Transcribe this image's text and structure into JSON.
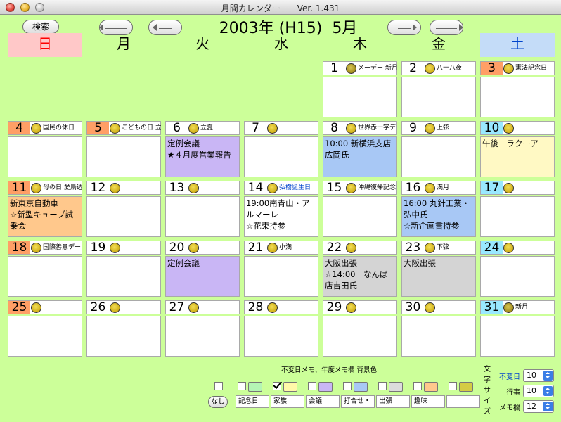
{
  "window": {
    "title": "月間カレンダー　　Ver. 1.431"
  },
  "toolbar": {
    "search_label": "検索"
  },
  "month_title": "2003年 (H15)  5月",
  "weekdays": [
    {
      "label": "日",
      "bg": "#ffc8c8",
      "color": "#ff0000"
    },
    {
      "label": "月",
      "bg": "",
      "color": "#000000"
    },
    {
      "label": "火",
      "bg": "",
      "color": "#000000"
    },
    {
      "label": "水",
      "bg": "",
      "color": "#000000"
    },
    {
      "label": "木",
      "bg": "",
      "color": "#000000"
    },
    {
      "label": "金",
      "bg": "",
      "color": "#000000"
    },
    {
      "label": "土",
      "bg": "#c4dcf8",
      "color": "#0044cc"
    }
  ],
  "colors": {
    "sunday_head": "#ff9f66",
    "saturday_head": "#99e8ff",
    "memo_purple": "#c9b6f5",
    "memo_blue": "#a8c8f5",
    "memo_yellow": "#fff9c4",
    "memo_orange": "#ffc88c",
    "memo_gray": "#d4d4d4"
  },
  "days": [
    {
      "day": "1",
      "holiday": "メーデー 新月",
      "notes": [],
      "memo": ""
    },
    {
      "day": "2",
      "holiday": "八十八夜",
      "notes": [],
      "memo": ""
    },
    {
      "day": "3",
      "holiday": "憲法記念日",
      "notes": [],
      "memo": "",
      "head": "sunday_head"
    },
    {
      "day": "4",
      "holiday": "国民の休日",
      "notes": [],
      "memo": "",
      "head": "sunday_head"
    },
    {
      "day": "5",
      "holiday": "こどもの日 立",
      "notes": [],
      "memo": "",
      "head": "sunday_head"
    },
    {
      "day": "6",
      "holiday": "立夏",
      "notes": [
        "定例会議",
        "★４月度営業報告"
      ],
      "memo": "memo_purple"
    },
    {
      "day": "7",
      "holiday": "",
      "notes": [],
      "memo": ""
    },
    {
      "day": "8",
      "holiday": "世界赤十字デ",
      "notes": [
        "10:00 新横浜支店",
        "広岡氏"
      ],
      "memo": "memo_blue"
    },
    {
      "day": "9",
      "holiday": "上弦",
      "notes": [],
      "memo": ""
    },
    {
      "day": "10",
      "holiday": "",
      "notes": [
        "午後　ラクーア"
      ],
      "memo": "memo_yellow",
      "head": "saturday_head"
    },
    {
      "day": "11",
      "holiday": "母の日 愛鳥週",
      "notes": [
        "新東京自動車",
        "☆新型キューブ試",
        "乗会"
      ],
      "memo": "memo_orange",
      "head": "sunday_head"
    },
    {
      "day": "12",
      "holiday": "",
      "notes": [],
      "memo": ""
    },
    {
      "day": "13",
      "holiday": "",
      "notes": [],
      "memo": ""
    },
    {
      "day": "14",
      "holiday": "弘樹誕生日",
      "holiday_color": "#0044cc",
      "notes": [
        "19:00南青山・ア",
        "ルマーレ",
        "☆花束持参"
      ],
      "memo": ""
    },
    {
      "day": "15",
      "holiday": "沖縄復帰記念",
      "notes": [],
      "memo": ""
    },
    {
      "day": "16",
      "holiday": "満月",
      "notes": [
        "16:00 丸針工業・",
        "弘中氏",
        "☆新企画書持参"
      ],
      "memo": "memo_blue"
    },
    {
      "day": "17",
      "holiday": "",
      "notes": [],
      "memo": "",
      "head": "saturday_head"
    },
    {
      "day": "18",
      "holiday": "国際善意デー",
      "notes": [],
      "memo": "",
      "head": "sunday_head"
    },
    {
      "day": "19",
      "holiday": "",
      "notes": [],
      "memo": ""
    },
    {
      "day": "20",
      "holiday": "",
      "notes": [
        "定例会議"
      ],
      "memo": "memo_purple"
    },
    {
      "day": "21",
      "holiday": "小満",
      "notes": [],
      "memo": ""
    },
    {
      "day": "22",
      "holiday": "",
      "notes": [
        "大阪出張",
        "☆14:00　なんば",
        "店吉田氏"
      ],
      "memo": "memo_gray"
    },
    {
      "day": "23",
      "holiday": "下弦",
      "notes": [
        "大阪出張"
      ],
      "memo": "memo_gray"
    },
    {
      "day": "24",
      "holiday": "",
      "notes": [],
      "memo": "",
      "head": "saturday_head"
    },
    {
      "day": "25",
      "holiday": "",
      "notes": [],
      "memo": "",
      "head": "sunday_head"
    },
    {
      "day": "26",
      "holiday": "",
      "notes": [],
      "memo": ""
    },
    {
      "day": "27",
      "holiday": "",
      "notes": [],
      "memo": ""
    },
    {
      "day": "28",
      "holiday": "",
      "notes": [],
      "memo": ""
    },
    {
      "day": "29",
      "holiday": "",
      "notes": [],
      "memo": ""
    },
    {
      "day": "30",
      "holiday": "",
      "notes": [],
      "memo": ""
    },
    {
      "day": "31",
      "holiday": "新月",
      "notes": [],
      "memo": "",
      "head": "saturday_head"
    }
  ],
  "memo_settings": {
    "caption": "不変日メモ、年度メモ欄 背景色",
    "none_label": "なし",
    "swatches": [
      {
        "color": "#b4f5b4",
        "checked": false
      },
      {
        "color": "#fff9a8",
        "checked": true
      },
      {
        "color": "#c9b6f5",
        "checked": false
      },
      {
        "color": "#a8c8f5",
        "checked": false
      },
      {
        "color": "#dcdcdc",
        "checked": false
      },
      {
        "color": "#ffc88c",
        "checked": false
      },
      {
        "color": "#d4cc44",
        "checked": false
      }
    ],
    "categories": [
      "記念日",
      "家族",
      "会議",
      "打合せ・",
      "出張",
      "趣味",
      ""
    ]
  },
  "font_size": {
    "label": "文字サイズ",
    "rows": [
      {
        "label": "不変日",
        "value": "10",
        "label_color": "#0044cc"
      },
      {
        "label": "行事",
        "value": "10",
        "label_color": "#000000"
      },
      {
        "label": "メモ欄",
        "value": "12",
        "label_color": "#000000"
      }
    ]
  }
}
